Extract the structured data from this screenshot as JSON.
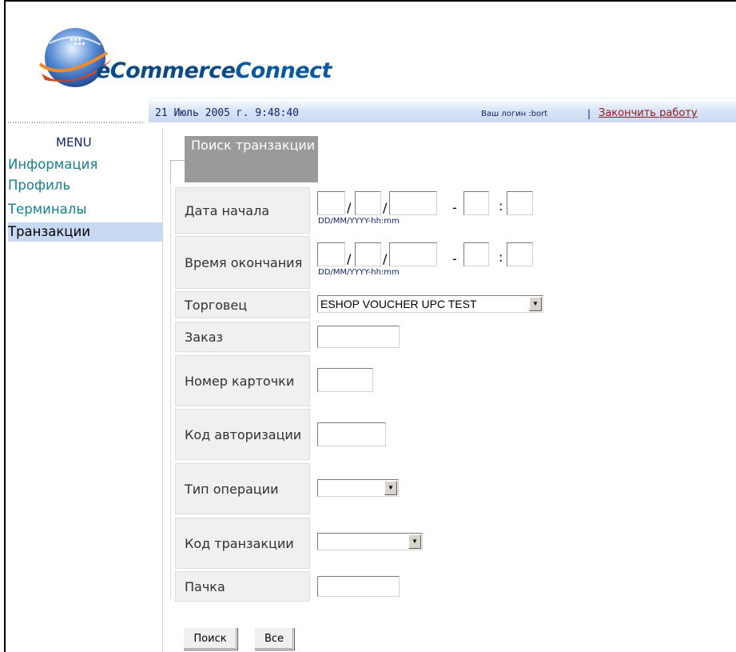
{
  "logo": {
    "brand_part1": "eCommerce",
    "brand_part2": "Connect"
  },
  "header": {
    "datetime": "21 Июль 2005 г. 9:48:40",
    "login_label": "Ваш логин :bort",
    "separator": "|",
    "logout_label": "Закончить работу"
  },
  "sidebar": {
    "title": "MENU",
    "items": [
      {
        "label": "Информация"
      },
      {
        "label": "Профиль"
      },
      {
        "label": "Терминалы"
      },
      {
        "label": "Транзакции"
      }
    ]
  },
  "form": {
    "tab_title": "Поиск транзакции",
    "date_sep": "/",
    "time_dash": "-",
    "time_colon": ":",
    "date_format_hint": "DD/MM/YYYY-hh:mm",
    "fields": {
      "date_start": {
        "label": "Дата начала"
      },
      "date_end": {
        "label": "Время окончания"
      },
      "merchant": {
        "label": "Торговец",
        "selected": "ESHOP VOUCHER UPC TEST"
      },
      "order": {
        "label": "Заказ",
        "value": ""
      },
      "card_number": {
        "label": "Номер карточки",
        "value": ""
      },
      "auth_code": {
        "label": "Код авторизации",
        "value": ""
      },
      "operation_type": {
        "label": "Тип операции",
        "selected": ""
      },
      "transaction_code": {
        "label": "Код транзакции",
        "selected": ""
      },
      "batch": {
        "label": "Пачка",
        "value": ""
      }
    },
    "search_button": "Поиск",
    "all_button": "Все"
  },
  "colors": {
    "brand_blue": "#0c4a86",
    "menu_teal": "#13808d",
    "menu_active_bg": "#c9d9f3",
    "logout_red": "#8b1a1a"
  }
}
